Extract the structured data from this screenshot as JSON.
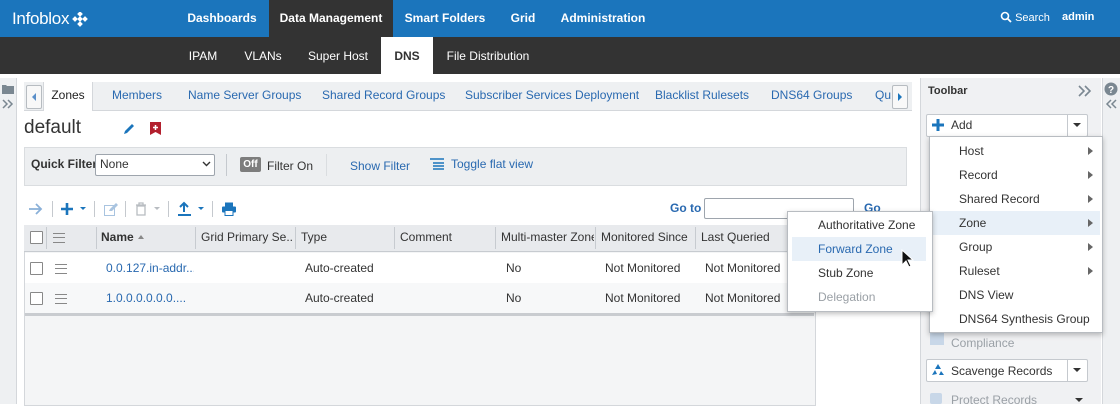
{
  "brand": {
    "logo_text": "Infoblox"
  },
  "topnav": {
    "items": [
      "Dashboards",
      "Data Management",
      "Smart Folders",
      "Grid",
      "Administration"
    ],
    "search_label": "Search",
    "user": "admin"
  },
  "subnav": {
    "items": [
      "IPAM",
      "VLANs",
      "Super Host",
      "DNS",
      "File Distribution"
    ]
  },
  "tabs": [
    "Zones",
    "Members",
    "Name Server Groups",
    "Shared Record Groups",
    "Subscriber Services Deployment",
    "Blacklist Rulesets",
    "DNS64 Groups",
    "Qu"
  ],
  "page": {
    "title": "default"
  },
  "filter": {
    "quick_filter_label": "Quick Filter",
    "quick_filter_value": "None",
    "off_badge": "Off",
    "filter_on_label": "Filter On",
    "show_filter": "Show Filter",
    "toggle_flat_view": "Toggle flat view"
  },
  "goto": {
    "label": "Go to",
    "go_button": "Go",
    "value": ""
  },
  "grid": {
    "columns": [
      "Name",
      "Grid Primary Se...",
      "Type",
      "Comment",
      "Multi-master Zone",
      "Monitored Since",
      "Last Queried"
    ],
    "rows": [
      {
        "name": "0.0.127.in-addr...",
        "grid_primary": "",
        "type": "Auto-created",
        "comment": "",
        "multi_master": "No",
        "monitored_since": "Not Monitored",
        "last_queried": "Not Monitored"
      },
      {
        "name": "1.0.0.0.0.0.0....",
        "grid_primary": "",
        "type": "Auto-created",
        "comment": "",
        "multi_master": "No",
        "monitored_since": "Not Monitored",
        "last_queried": "Not Monitored"
      }
    ]
  },
  "toolbar": {
    "title": "Toolbar",
    "add_label": "Add",
    "items_below": [
      "Compliance",
      "Scavenge Records",
      "Protect Records"
    ]
  },
  "add_menu": {
    "items": [
      "Host",
      "Record",
      "Shared Record",
      "Zone",
      "Group",
      "Ruleset",
      "DNS View",
      "DNS64 Synthesis Group"
    ]
  },
  "zone_submenu": {
    "items": [
      "Authoritative Zone",
      "Forward Zone",
      "Stub Zone",
      "Delegation"
    ]
  },
  "colors": {
    "brand_blue": "#1b75bc",
    "dark_bar": "#333333",
    "link_blue": "#2969b0"
  }
}
